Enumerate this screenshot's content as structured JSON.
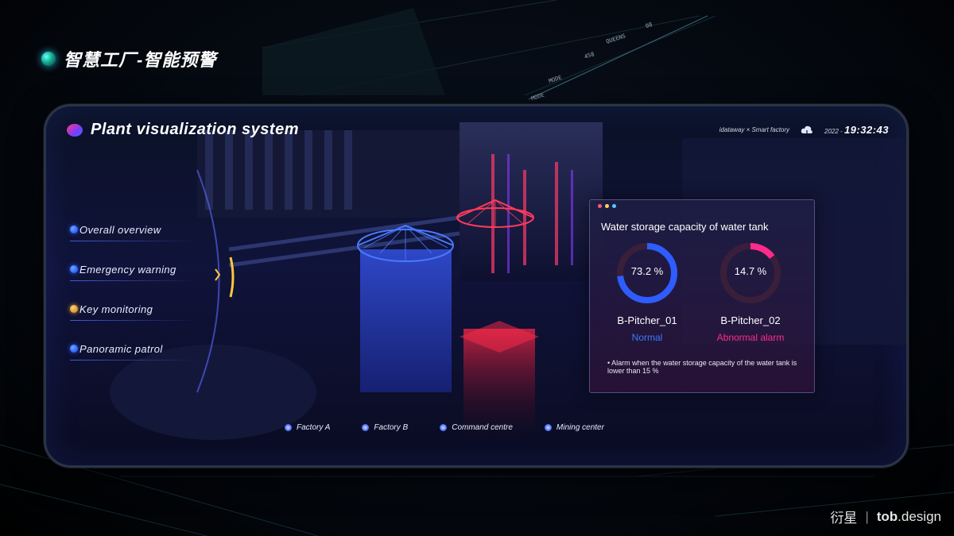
{
  "slide_title": "智慧工厂-智能预警",
  "hud": {
    "queens": "QUEENS",
    "num_a": "458",
    "num_b": "08",
    "mode_a": "MODE",
    "mode_b": "MODE"
  },
  "app": {
    "title": "Plant visualization system",
    "brand": "idataway × Smart factory",
    "date": "2022 -",
    "time": "19:32:43"
  },
  "nav": {
    "items": [
      {
        "label": "Overall overview"
      },
      {
        "label": "Emergency warning"
      },
      {
        "label": "Key monitoring"
      },
      {
        "label": "Panoramic patrol"
      }
    ]
  },
  "panel": {
    "title": "Water storage capacity of water tank",
    "gauges": [
      {
        "value_text": "73.2 %",
        "value": 73.2,
        "name": "B-Pitcher_01",
        "status": "Normal",
        "color": "#2f5cff",
        "status_color": "#3a7bff"
      },
      {
        "value_text": "14.7 %",
        "value": 14.7,
        "name": "B-Pitcher_02",
        "status": "Abnormal alarm",
        "color": "#ff2a8a",
        "status_color": "#ff2a8a"
      }
    ],
    "note": "• Alarm when the water storage capacity of the water tank is lower than 15 %"
  },
  "factory_bar": {
    "items": [
      {
        "label": "Factory A"
      },
      {
        "label": "Factory B"
      },
      {
        "label": "Command centre"
      },
      {
        "label": "Mining center"
      }
    ]
  },
  "footer": {
    "cn_brand": "衍星",
    "separator": "|",
    "tob": "tob",
    "design": ".design"
  },
  "colors": {
    "accent_blue": "#2f5cff",
    "accent_pink": "#ff2a8a",
    "gold": "#e0a020"
  }
}
